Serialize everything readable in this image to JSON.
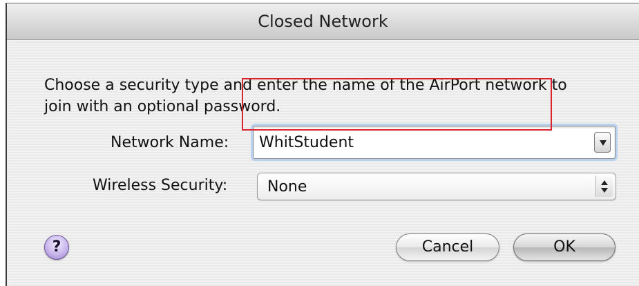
{
  "dialog": {
    "title": "Closed Network",
    "message": "Choose a security type and enter the name of the AirPort network to join with an optional password."
  },
  "network_name": {
    "label": "Network Name:",
    "value": "WhitStudent",
    "dropdown_icon": "chevron-down-icon"
  },
  "wireless_security": {
    "label": "Wireless Security:",
    "value": "None",
    "stepper_icon": "up-down-arrows-icon"
  },
  "buttons": {
    "help_label": "?",
    "cancel_label": "Cancel",
    "ok_label": "OK"
  },
  "annotation": {
    "highlight_color": "#d9232e"
  }
}
